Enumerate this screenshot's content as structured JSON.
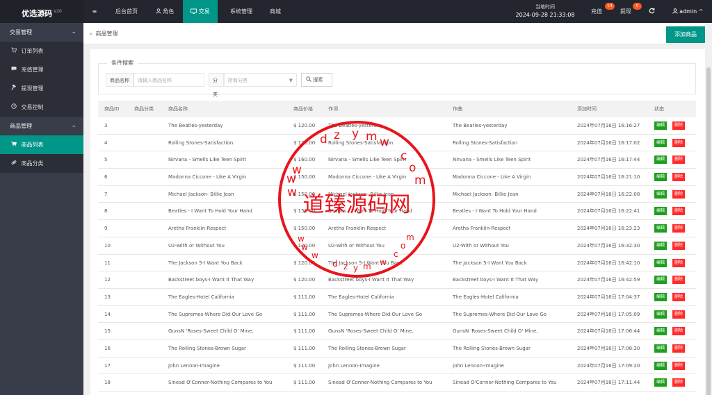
{
  "app": {
    "title": "优选源码",
    "version": "V20"
  },
  "topnav": {
    "menu_icon": "≡",
    "items": [
      {
        "label": "后台首页"
      },
      {
        "label": "角色",
        "icon": "user-icon"
      },
      {
        "label": "交易",
        "icon": "trade-icon"
      },
      {
        "label": "系统管理"
      },
      {
        "label": "商城"
      }
    ],
    "time_label": "当地时间",
    "time_value": "2024-09-28 21:33:08",
    "recharge_label": "充值",
    "recharge_badge": "14",
    "withdraw_label": "提现",
    "withdraw_badge": "0",
    "refresh_icon": "refresh-icon",
    "user": "admin",
    "colors": {
      "topbar": "#23262e",
      "accent": "#009688",
      "badge": "#ff5722"
    }
  },
  "sidebar": {
    "groups": [
      {
        "label": "交易管理",
        "items": [
          {
            "label": "订单列表",
            "icon": "cart-icon"
          },
          {
            "label": "充值管理",
            "icon": "chat-icon"
          },
          {
            "label": "提现管理",
            "icon": "hammer-icon"
          },
          {
            "label": "交易控制",
            "icon": "clock-icon"
          }
        ]
      },
      {
        "label": "商品管理",
        "items": [
          {
            "label": "商品列表",
            "icon": "cart-icon",
            "active": true
          },
          {
            "label": "商品分类",
            "icon": "link-icon"
          }
        ]
      }
    ]
  },
  "breadcrumb": {
    "sep": "»",
    "current": "商品管理"
  },
  "actions": {
    "add_label": "添加商品"
  },
  "filter": {
    "legend": "条件搜索",
    "name_label": "商品名称",
    "name_placeholder": "请输入商品名称",
    "category_label": "分类",
    "category_value": "所有分类",
    "search_label": "搜索"
  },
  "table": {
    "headers": [
      "商品ID",
      "商品分类",
      "商品名称",
      "商品价格",
      "作词",
      "作曲",
      "添加时间",
      "状态"
    ],
    "edit_label": "编辑",
    "delete_label": "删除",
    "rows": [
      {
        "id": "3",
        "category": "",
        "name": "The Beatles-yesterday",
        "price": "$ 120.00",
        "lyrics": "The Beatles-yesterday",
        "composer": "The Beatles-yesterday",
        "time": "2024年07月16日 16:16:27"
      },
      {
        "id": "4",
        "category": "",
        "name": "Rolling Stones-Satisfaction",
        "price": "$ 120.00",
        "lyrics": "Rolling Stones-Satisfaction",
        "composer": "Rolling Stones-Satisfaction",
        "time": "2024年07月16日 16:17:02"
      },
      {
        "id": "5",
        "category": "",
        "name": "Nirvana - Smells Like Teen Spirit",
        "price": "$ 160.00",
        "lyrics": "Nirvana - Smells Like Teen Spirit",
        "composer": "Nirvana - Smells Like Teen Spirit",
        "time": "2024年07月16日 16:17:44"
      },
      {
        "id": "6",
        "category": "",
        "name": "Madonna Ciccone - Like A Virgin",
        "price": "$ 150.00",
        "lyrics": "Madonna Ciccone - Like A Virgin",
        "composer": "Madonna Ciccone - Like A Virgin",
        "time": "2024年07月16日 16:21:10"
      },
      {
        "id": "7",
        "category": "",
        "name": "Michael Jackson- Billie Jean",
        "price": "$ 150.00",
        "lyrics": "Michael Jackson- Billie Jean",
        "composer": "Michael Jackson- Billie Jean",
        "time": "2024年07月16日 16:22:08"
      },
      {
        "id": "8",
        "category": "",
        "name": "Beatles - I Want To Hold Your Hand",
        "price": "$ 150.00",
        "lyrics": "Beatles - I Want To Hold Your Hand",
        "composer": "Beatles - I Want To Hold Your Hand",
        "time": "2024年07月16日 16:22:41"
      },
      {
        "id": "9",
        "category": "",
        "name": "Aretha Franklin-Respect",
        "price": "$ 150.00",
        "lyrics": "Aretha Franklin-Respect",
        "composer": "Aretha Franklin-Respect",
        "time": "2024年07月16日 16:23:23"
      },
      {
        "id": "10",
        "category": "",
        "name": "U2-With or Without You",
        "price": "$ 120.00",
        "lyrics": "U2-With or Without You",
        "composer": "U2-With or Without You",
        "time": "2024年07月16日 16:32:30"
      },
      {
        "id": "11",
        "category": "",
        "name": "The Jackson 5-I Want You Back",
        "price": "$ 120.00",
        "lyrics": "The Jackson 5-I Want You Back",
        "composer": "The Jackson 5-I Want You Back",
        "time": "2024年07月16日 16:42:10"
      },
      {
        "id": "12",
        "category": "",
        "name": "Backstreet boys-I Want It That Way",
        "price": "$ 120.00",
        "lyrics": "Backstreet boys-I Want It That Way",
        "composer": "Backstreet boys-I Want It That Way",
        "time": "2024年07月16日 16:42:59"
      },
      {
        "id": "13",
        "category": "",
        "name": "The Eagles-Hotel California",
        "price": "$ 111.00",
        "lyrics": "The Eagles-Hotel California",
        "composer": "The Eagles-Hotel California",
        "time": "2024年07月16日 17:04:37"
      },
      {
        "id": "14",
        "category": "",
        "name": "The Supremes-Where Did Our Love Go",
        "price": "$ 111.00",
        "lyrics": "The Supremes-Where Did Our Love Go",
        "composer": "The Supremes-Where Did Our Love Go",
        "time": "2024年07月16日 17:05:09"
      },
      {
        "id": "15",
        "category": "",
        "name": "GunsN   'Roses-Sweet Child O' Mine,",
        "price": "$ 111.00",
        "lyrics": "GunsN   'Roses-Sweet Child O' Mine,",
        "composer": "GunsN   'Roses-Sweet Child O' Mine,",
        "time": "2024年07月16日 17:06:44"
      },
      {
        "id": "16",
        "category": "",
        "name": "The Rolling Stones-Brown Sugar",
        "price": "$ 111.00",
        "lyrics": "The Rolling Stones-Brown Sugar",
        "composer": "The Rolling Stones-Brown Sugar",
        "time": "2024年07月16日 17:08:30"
      },
      {
        "id": "17",
        "category": "",
        "name": "John Lennon-Imagine",
        "price": "$ 111.00",
        "lyrics": "John Lennon-Imagine",
        "composer": "John Lennon-Imagine",
        "time": "2024年07月16日 17:09:20"
      },
      {
        "id": "18",
        "category": "",
        "name": "Sinead O'Connor-Nothing Compares to You",
        "price": "$ 111.00",
        "lyrics": "Sinead O'Connor-Nothing Compares to You",
        "composer": "Sinead O'Connor-Nothing Compares to You",
        "time": "2024年07月16日 17:11:44"
      }
    ]
  },
  "watermark": {
    "text": "道臻源码网",
    "url_text": "www.dzym.com",
    "color": "#e8141c"
  }
}
